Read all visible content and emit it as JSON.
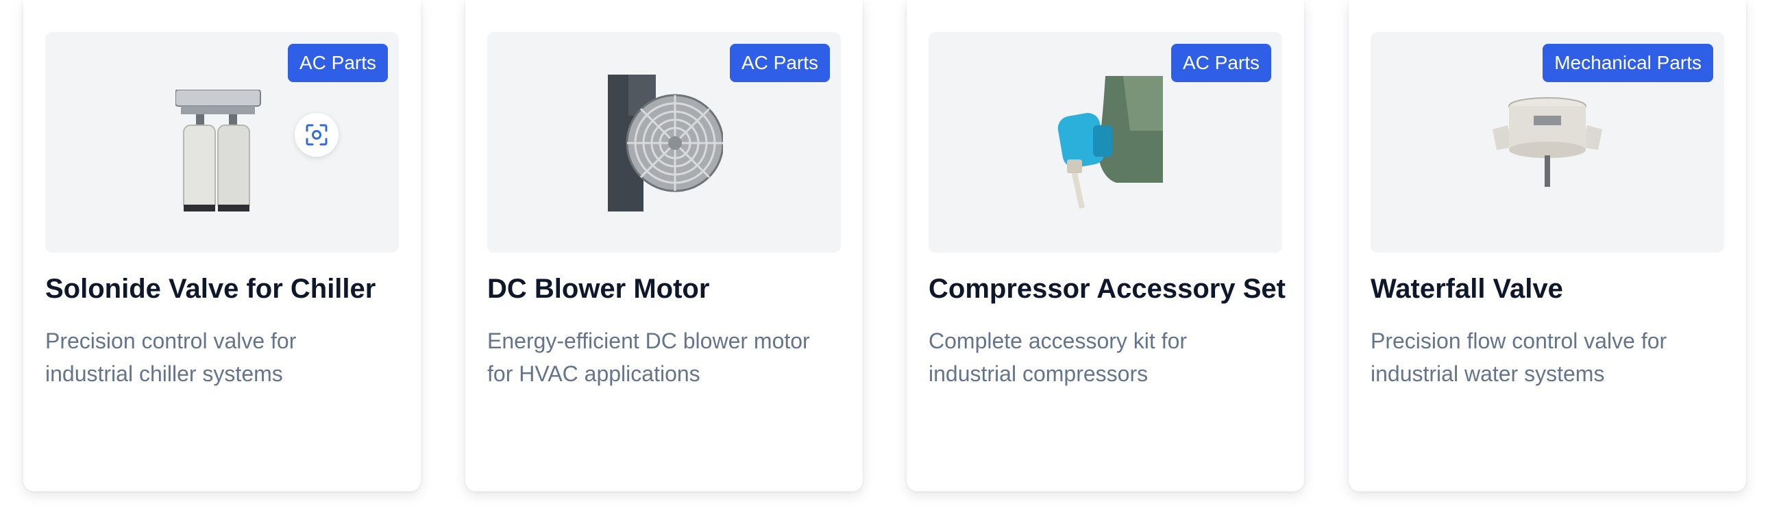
{
  "products": [
    {
      "category": "AC Parts",
      "title": "Solonide Valve for Chiller",
      "description": "Precision control valve for industrial chiller systems",
      "image_icon": "solenoid-valve-photo"
    },
    {
      "category": "AC Parts",
      "title": "DC Blower Motor",
      "description": "Energy-efficient DC blower motor for HVAC applications",
      "image_icon": "blower-fan-photo"
    },
    {
      "category": "AC Parts",
      "title": "Compressor Accessory Set",
      "description": "Complete accessory kit for industrial compressors",
      "image_icon": "compressor-accessory-photo"
    },
    {
      "category": "Mechanical Parts",
      "title": "Waterfall Valve",
      "description": "Precision flow control valve for industrial water systems",
      "image_icon": "waterfall-valve-photo"
    }
  ],
  "overlay": {
    "icon": "visual-search-icon"
  },
  "colors": {
    "badge": "#2f5fe6",
    "title": "#0f172a",
    "description": "#64748b",
    "media_bg": "#f3f4f6"
  }
}
